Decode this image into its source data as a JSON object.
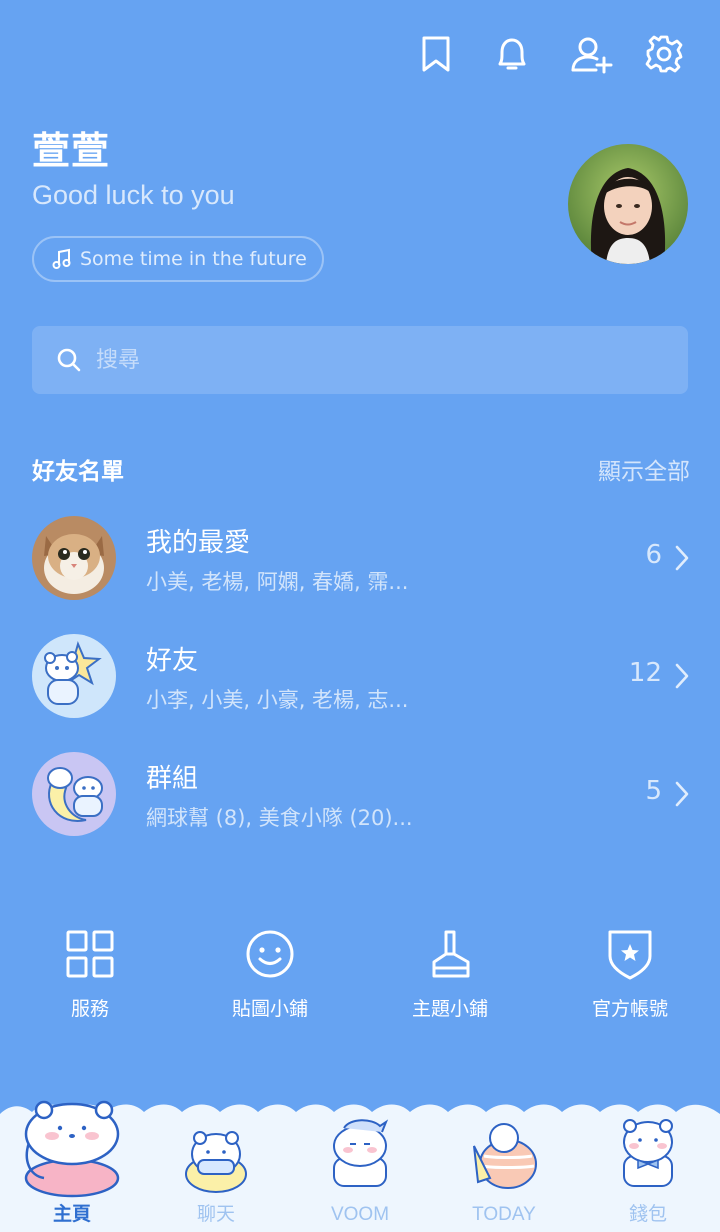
{
  "profile": {
    "name": "萱萱",
    "status_message": "Good luck to you",
    "music": "Some time in the future"
  },
  "search": {
    "placeholder": "搜尋"
  },
  "friends_section": {
    "title": "好友名單",
    "show_all": "顯示全部",
    "rows": [
      {
        "name": "我的最愛",
        "members": "小美, 老楊, 阿嫻, 春嬌, 霈...",
        "count": "6"
      },
      {
        "name": "好友",
        "members": "小李, 小美, 小豪, 老楊, 志...",
        "count": "12"
      },
      {
        "name": "群組",
        "members": "網球幫 (8), 美食小隊 (20)...",
        "count": "5"
      }
    ]
  },
  "quick_actions": [
    {
      "label": "服務",
      "icon": "grid-icon"
    },
    {
      "label": "貼圖小鋪",
      "icon": "smiley-icon"
    },
    {
      "label": "主題小鋪",
      "icon": "brush-icon"
    },
    {
      "label": "官方帳號",
      "icon": "shield-star-icon"
    }
  ],
  "bottom_nav": [
    {
      "label": "主頁",
      "active": true
    },
    {
      "label": "聊天",
      "active": false
    },
    {
      "label": "VOOM",
      "active": false
    },
    {
      "label": "TODAY",
      "active": false
    },
    {
      "label": "錢包",
      "active": false
    }
  ],
  "colors": {
    "background": "#66a3f2",
    "nav_active": "#2f6fd0",
    "nav_inactive": "#9fc3f0",
    "cloud": "#eef6fe"
  }
}
